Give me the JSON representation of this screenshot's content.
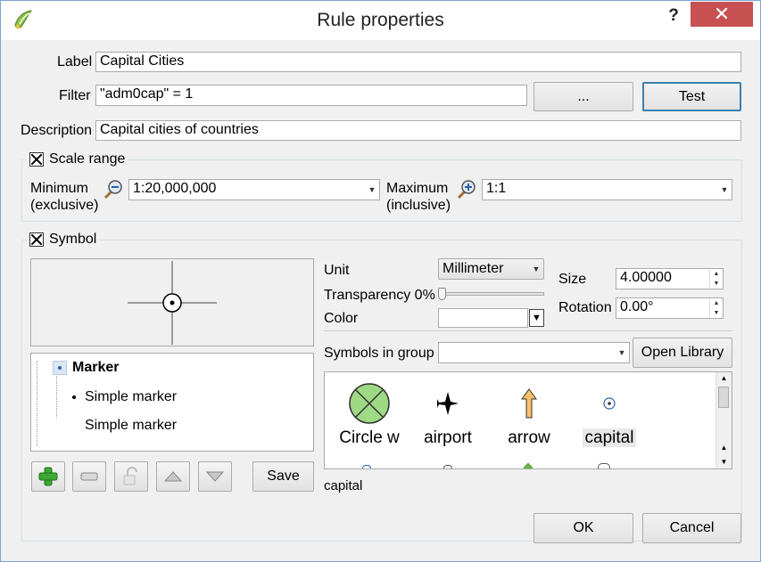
{
  "window": {
    "title": "Rule properties",
    "help_label": "?",
    "close_label": "✕"
  },
  "form": {
    "label_caption": "Label",
    "label_value": "Capital Cities",
    "filter_caption": "Filter",
    "filter_value": "\"adm0cap\"  =  1",
    "filter_dots_button": "...",
    "test_button": "Test",
    "description_caption": "Description",
    "description_value": "Capital cities of countries"
  },
  "scale_range": {
    "title": "Scale range",
    "checked": true,
    "minimum_label_1": "Minimum",
    "minimum_label_2": "(exclusive)",
    "minimum_value": "1:20,000,000",
    "maximum_label_1": "Maximum",
    "maximum_label_2": "(inclusive)",
    "maximum_value": "1:1"
  },
  "symbol": {
    "title": "Symbol",
    "checked": true,
    "unit_label": "Unit",
    "unit_value": "Millimeter",
    "transparency_label": "Transparency 0%",
    "transparency_value": 0,
    "color_label": "Color",
    "color_value": "#ffffff",
    "size_label": "Size",
    "size_value": "4.00000",
    "rotation_label": "Rotation",
    "rotation_value": "0.00°",
    "symbols_in_group_label": "Symbols in group",
    "group_value": "",
    "open_library_button": "Open Library",
    "save_button": "Save",
    "tree": [
      {
        "label": "Marker",
        "level": 0
      },
      {
        "label": "Simple marker",
        "level": 1
      },
      {
        "label": "Simple marker",
        "level": 1
      }
    ],
    "library": [
      {
        "name": "Circle w",
        "icon": "circle-cross-icon"
      },
      {
        "name": "airport",
        "icon": "airplane-icon"
      },
      {
        "name": "arrow",
        "icon": "arrow-up-icon"
      },
      {
        "name": "capital",
        "icon": "capital-dot-icon",
        "selected": true
      }
    ],
    "selected_symbol_name": "capital"
  },
  "footer": {
    "ok_button": "OK",
    "cancel_button": "Cancel"
  },
  "colors": {
    "close_bg": "#c75050",
    "title_bg": "#ffffff",
    "dialog_bg": "#f0f0f0",
    "default_button_border": "#3c7fb1",
    "circle_fill": "#9ed983",
    "arrow_fill": "#f5c26b"
  }
}
